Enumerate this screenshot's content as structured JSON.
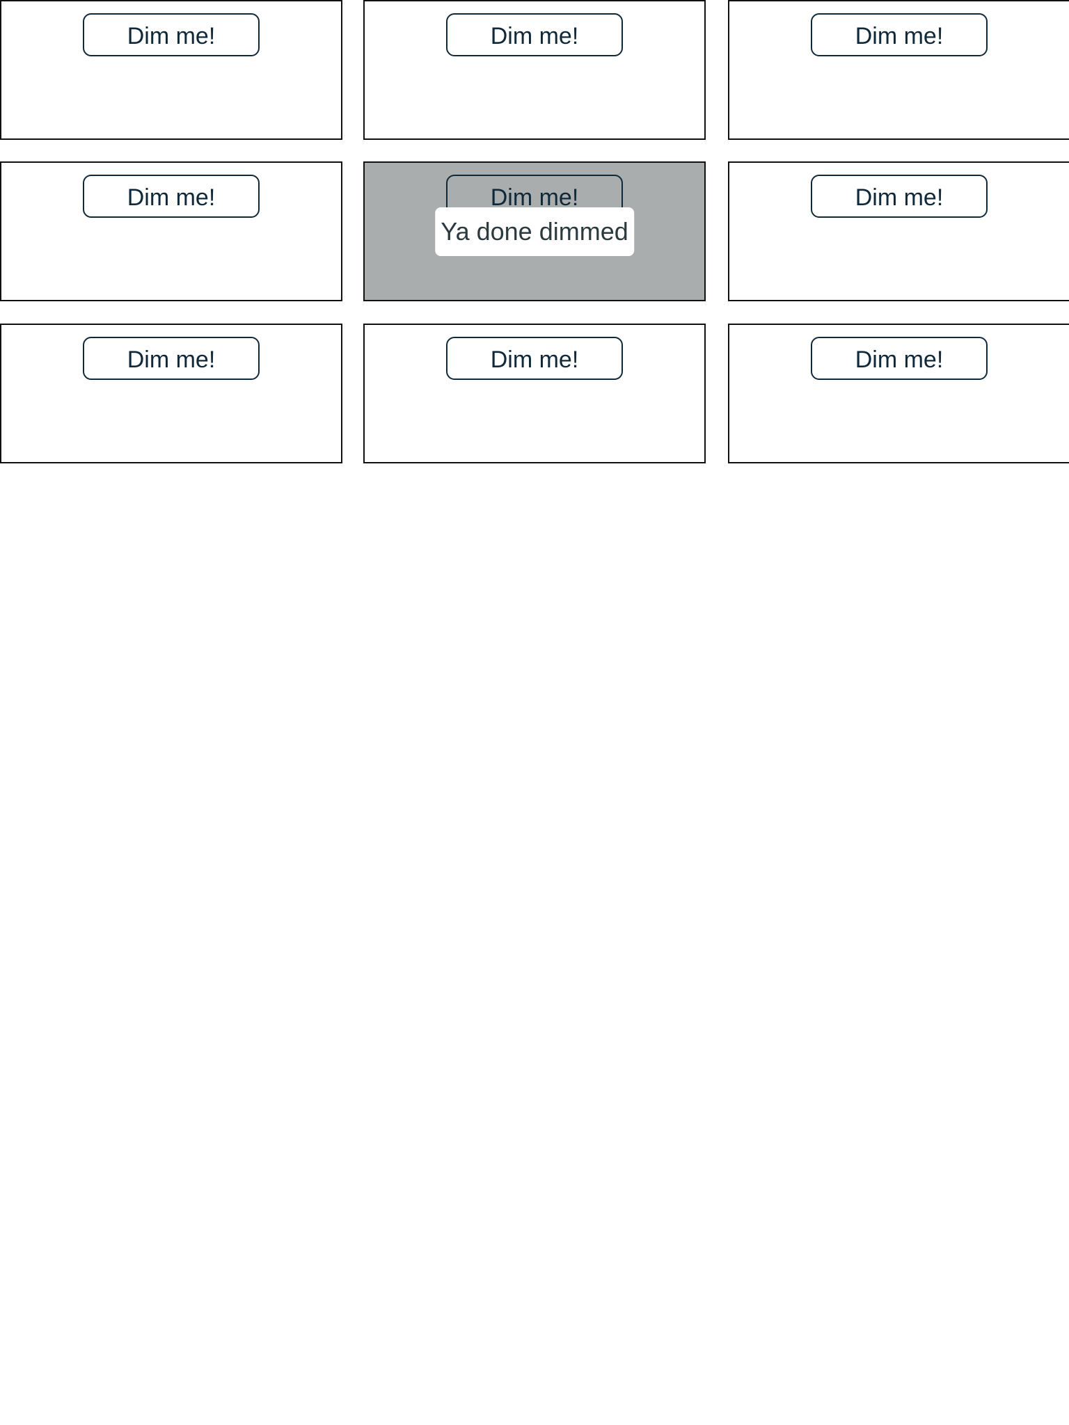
{
  "colors": {
    "dim_overlay": "#a9adad",
    "button_border": "#10293a",
    "message_text": "#2b3a3f"
  },
  "cells": [
    {
      "button_label": "Dim me!",
      "dimmed": false
    },
    {
      "button_label": "Dim me!",
      "dimmed": false
    },
    {
      "button_label": "Dim me!",
      "dimmed": false
    },
    {
      "button_label": "Dim me!",
      "dimmed": false
    },
    {
      "button_label": "Dim me!",
      "dimmed": true,
      "message": "Ya done dimmed"
    },
    {
      "button_label": "Dim me!",
      "dimmed": false
    },
    {
      "button_label": "Dim me!",
      "dimmed": false
    },
    {
      "button_label": "Dim me!",
      "dimmed": false
    },
    {
      "button_label": "Dim me!",
      "dimmed": false
    }
  ]
}
